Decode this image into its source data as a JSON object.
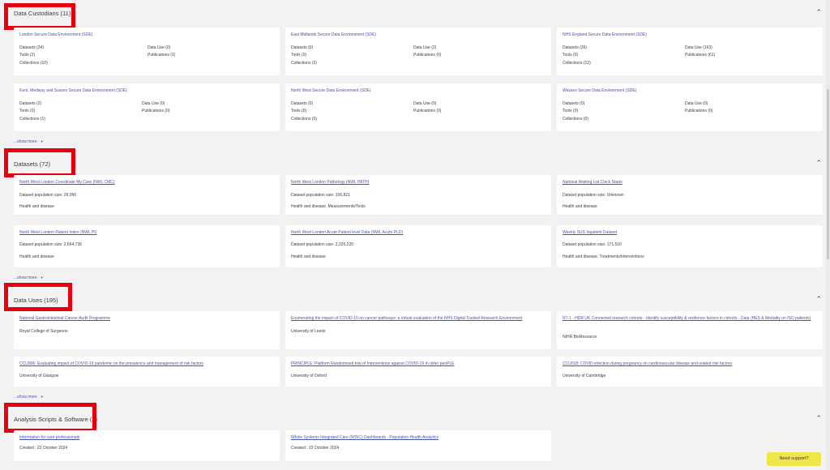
{
  "custodians": {
    "title": "Data Custodians (11)",
    "show_more": "...show more",
    "cards": [
      {
        "name": "London Secure Data Environment (SDE)",
        "datasets": "Datasets (24)",
        "tools": "Tools (2)",
        "collections": "Collections (10)",
        "data_use": "Data Use (0)",
        "publications": "Publications (1)"
      },
      {
        "name": "East Midlands Secure Data Environment (SDE)",
        "datasets": "Datasets (0)",
        "tools": "Tools (0)",
        "collections": "Collections (2)",
        "data_use": "Data Use (2)",
        "publications": "Publications (0)"
      },
      {
        "name": "NHS England Secure Data Environment (SDE)",
        "datasets": "Datasets (36)",
        "tools": "Tools (0)",
        "collections": "Collections (12)",
        "data_use": "Data Use (163)",
        "publications": "Publications (61)"
      },
      {
        "name": "Kent, Medway and Sussex Secure Data Environment (SDE)",
        "datasets": "Datasets (2)",
        "tools": "Tools (0)",
        "collections": "Collections (1)",
        "data_use": "Data Use (0)",
        "publications": "Publications (0)"
      },
      {
        "name": "North West Secure Data Environment (SDE)",
        "datasets": "Datasets (0)",
        "tools": "Tools (0)",
        "collections": "Collections (0)",
        "data_use": "Data Use (0)",
        "publications": "Publications (0)"
      },
      {
        "name": "Wessex Secure Data Environment (SDE)",
        "datasets": "Datasets (0)",
        "tools": "Tools (0)",
        "collections": "Collections (0)",
        "data_use": "Data Use (0)",
        "publications": "Publications (0)"
      }
    ]
  },
  "datasets": {
    "title": "Datasets (72)",
    "show_more": "...show more",
    "cards": [
      {
        "name": "North West London Coordinate My Care (NWL CMC)",
        "population": "Dataset population size: 29,056",
        "category": "Health and disease"
      },
      {
        "name": "North West London Pathology (NWL PATH)",
        "population": "Dataset population size: 106,821",
        "category": "Health and disease, Measurements/Tests"
      },
      {
        "name": "National Waiting List Clock Starts",
        "population": "Dataset population size: Unknown",
        "category": "Health and disease"
      },
      {
        "name": "North West London Patient Index (NWL PI)",
        "population": "Dataset population size: 2,664,736",
        "category": "Health and disease"
      },
      {
        "name": "North West London Acute Patient level Data (NWL Acute PLD)",
        "population": "Dataset population size: 2,325,220",
        "category": "Health and disease"
      },
      {
        "name": "Weekly SUS Inpatient Dataset",
        "population": "Dataset population size: 171,510",
        "category": "Health and disease, Treatments/Interventions"
      }
    ]
  },
  "data_uses": {
    "title": "Data Uses (195)",
    "show_more": "...show more",
    "cards": [
      {
        "name": "National Gastrointestinal Cancer Audit Programme",
        "org": "Royal College of Surgeons"
      },
      {
        "name": "Enumerating the impact of COVID-19 on cancer pathways: a robust evaluation of the NHS Digital Trusted Research Environment",
        "org": "University of Leeds"
      },
      {
        "name": "RT-1 - HDR UK Connected research cohorts - Identify susceptibility & resilience factors in cohorts - Data (HES & Mortality on ISO patients)",
        "org": "NIHR BioResource"
      },
      {
        "name": "CCU006: Evaluating impact of COVID-19 pandemic on the prevalence and management of risk factors",
        "org": "University of Glasgow"
      },
      {
        "name": "PRINCIPLE: Platform Randomised trial of Interventions against COVID-19 In older peoPLE",
        "org": "University of Oxford"
      },
      {
        "name": "CCU018: COVID infection during pregnancy on cardiovascular disease and related risk factors",
        "org": "University of Cambridge"
      }
    ]
  },
  "scripts": {
    "title": "Analysis Scripts & Software (2)",
    "cards": [
      {
        "name": "Information for care professionals",
        "created": "Created : 22 October 2024"
      },
      {
        "name": "Whole Systems Integrated Care (WSIC) Dashboards - Population Health Analytics",
        "created": "Created : 22 October 2024"
      }
    ]
  },
  "support_button": "Need support?",
  "icons": {
    "collapse": "chevron-up-icon",
    "expand": "caret-down-icon"
  },
  "colors": {
    "highlight": "#e8000e",
    "link": "#4454a8",
    "support": "#f0e54a"
  }
}
